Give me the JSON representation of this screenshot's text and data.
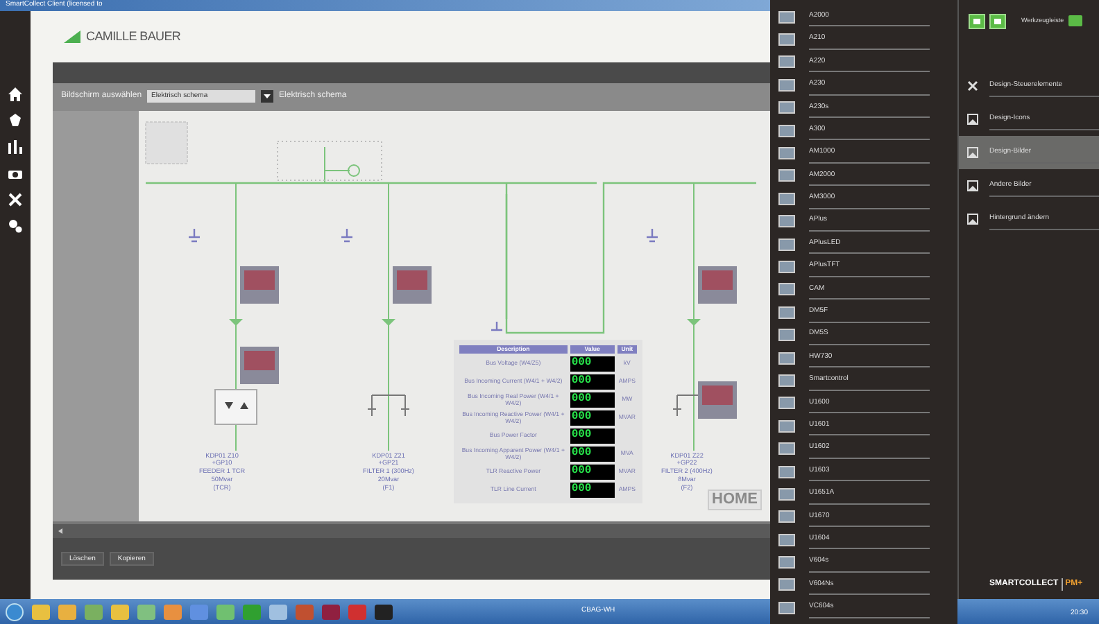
{
  "window": {
    "title": "SmartCollect Client (licensed to"
  },
  "logo": "CAMILLE BAUER",
  "screen_select": {
    "label": "Bildschirm auswählen",
    "value": "Elektrisch schema",
    "title": "Elektrisch schema"
  },
  "feeders": [
    {
      "lines": [
        "KDP01 Z10",
        "+GP10",
        "FEEDER 1 TCR",
        "50Mvar",
        "(TCR)"
      ]
    },
    {
      "lines": [
        "KDP01 Z21",
        "+GP21",
        "FILTER 1 (300Hz)",
        "20Mvar",
        "(F1)"
      ]
    },
    {
      "lines": [
        "KDP01 Z22",
        "+GP22",
        "FILTER 2 (400Hz)",
        "8Mvar",
        "(F2)"
      ]
    }
  ],
  "measurements": {
    "columns": [
      "Description",
      "Value",
      "Unit"
    ],
    "rows": [
      {
        "description": "Bus Voltage (W4/Z5)",
        "value": "000",
        "unit": "kV"
      },
      {
        "description": "Bus Incoming Current (W4/1 + W4/2)",
        "value": "000",
        "unit": "AMPS"
      },
      {
        "description": "Bus Incoming Real Power (W4/1 + W4/2)",
        "value": "000",
        "unit": "MW"
      },
      {
        "description": "Bus Incoming Reactive Power (W4/1 + W4/2)",
        "value": "000",
        "unit": "MVAR"
      },
      {
        "description": "Bus Power Factor",
        "value": "000",
        "unit": ""
      },
      {
        "description": "Bus Incoming Apparent Power (W4/1 + W4/2)",
        "value": "000",
        "unit": "MVA"
      },
      {
        "description": "TLR Reactive Power",
        "value": "000",
        "unit": "MVAR"
      },
      {
        "description": "TLR Line Current",
        "value": "000",
        "unit": "AMPS"
      }
    ]
  },
  "home_label": "HOME",
  "buttons": [
    "Löschen",
    "Kopieren"
  ],
  "device_list": [
    "A2000",
    "A210",
    "A220",
    "A230",
    "A230s",
    "A300",
    "AM1000",
    "AM2000",
    "AM3000",
    "APlus",
    "APlusLED",
    "APlusTFT",
    "CAM",
    "DM5F",
    "DM5S",
    "HW730",
    "Smartcontrol",
    "U1600",
    "U1601",
    "U1602",
    "U1603",
    "U1651A",
    "U1670",
    "U1604",
    "V604s",
    "V604Ns",
    "VC604s"
  ],
  "toolbar": {
    "label": "Werkzeugleiste",
    "on": true
  },
  "menu": [
    {
      "label": "Design-Steuerelemente",
      "selected": false
    },
    {
      "label": "Design-Icons",
      "selected": false
    },
    {
      "label": "Design-Bilder",
      "selected": true
    },
    {
      "label": "Andere Bilder",
      "selected": false
    },
    {
      "label": "Hintergrund ändern",
      "selected": false
    }
  ],
  "brand": {
    "name": "SMARTCOLLECT",
    "suffix": "PM+"
  },
  "taskbar": {
    "tray_text": "CBAG-WH",
    "time": "20:30"
  }
}
